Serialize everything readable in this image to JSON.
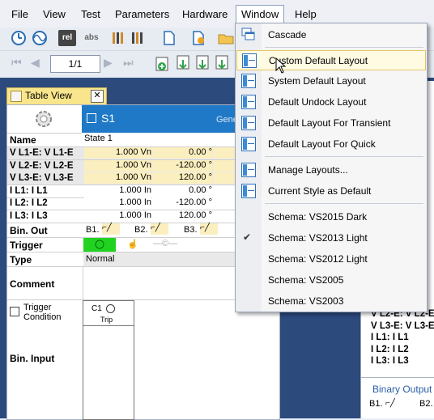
{
  "menubar": {
    "items": [
      "File",
      "View",
      "Test",
      "Parameters",
      "Hardware",
      "Window",
      "Help"
    ]
  },
  "toolbar": {
    "page_value": "1/1"
  },
  "table_view": {
    "tab_label": "Table View",
    "state_header": "S1",
    "right_header_hint": "Gene",
    "name_label": "Name",
    "name_value": "State 1",
    "rows": [
      {
        "label": "V L1-E: V L1-E",
        "v1": "1.000 Vn",
        "v2": "0.00 °"
      },
      {
        "label": "V L2-E: V L2-E",
        "v1": "1.000 Vn",
        "v2": "-120.00 °"
      },
      {
        "label": "V L3-E: V L3-E",
        "v1": "1.000 Vn",
        "v2": "120.00 °"
      },
      {
        "label": "I L1: I L1",
        "v1": "1.000 In",
        "v2": "0.00 °"
      },
      {
        "label": "I L2: I L2",
        "v1": "1.000 In",
        "v2": "-120.00 °"
      },
      {
        "label": "I L3: I L3",
        "v1": "1.000 In",
        "v2": "120.00 °"
      }
    ],
    "bin_out_label": "Bin. Out",
    "bin_out_items": [
      "B1.",
      "B2.",
      "B3."
    ],
    "trigger_label": "Trigger",
    "type_label": "Type",
    "type_value": "Normal",
    "comment_label": "Comment",
    "trigger_condition_label": "Trigger\nCondition",
    "bin_input_label": "Bin. Input",
    "bin_input_c1": "C1",
    "bin_input_trip": "Trip"
  },
  "right_panel": {
    "rows": [
      "V L2-E: V L2-E",
      "V L3-E: V L3-E",
      "I L1: I L1",
      "I L2: I L2",
      "I L3: I L3"
    ],
    "section_title": "Binary Output",
    "b1": "B1.",
    "b2": "B2."
  },
  "window_menu": {
    "items": [
      {
        "label": "Cascade",
        "icon": "cascade-icon"
      },
      {
        "label": "Custom Default Layout",
        "icon": "layout-icon",
        "highlighted": true
      },
      {
        "label": "System Default Layout",
        "icon": "layout-icon"
      },
      {
        "label": "Default Undock Layout",
        "icon": "layout-icon"
      },
      {
        "label": "Default Layout For Transient",
        "icon": "layout-icon"
      },
      {
        "label": "Default Layout For Quick",
        "icon": "layout-icon"
      },
      {
        "label": "Manage Layouts...",
        "icon": "layout-icon"
      },
      {
        "label": "Current Style as Default",
        "icon": "layout-icon"
      },
      {
        "label": "Schema: VS2015 Dark",
        "icon": ""
      },
      {
        "label": "Schema: VS2013 Light",
        "icon": "check-icon",
        "checked": true
      },
      {
        "label": "Schema: VS2012 Light",
        "icon": ""
      },
      {
        "label": "Schema: VS2005",
        "icon": ""
      },
      {
        "label": "Schema: VS2003",
        "icon": ""
      }
    ]
  },
  "colors": {
    "workspace": "#2d4a7d",
    "state_header": "#1f79c6",
    "menu_highlight": "#fffbe3",
    "grid_value_bg": "#fcefbf",
    "trigger_green": "#21d321"
  }
}
